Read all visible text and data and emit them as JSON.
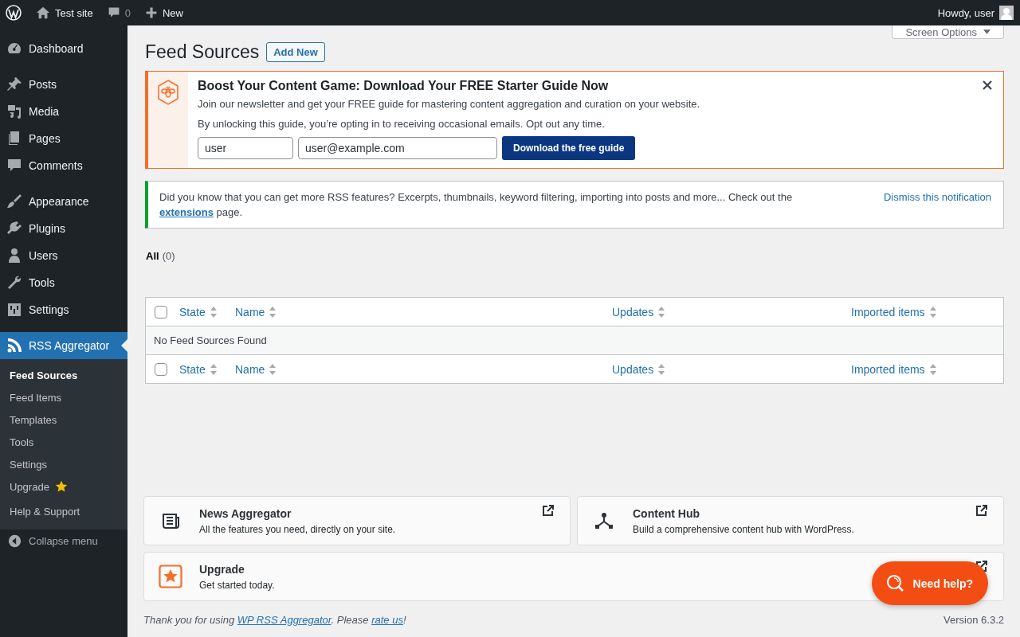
{
  "admin_bar": {
    "site_name": "Test site",
    "comments_count": "0",
    "new_label": "New",
    "greeting": "Howdy, user"
  },
  "sidebar": {
    "groups": [
      [
        {
          "label": "Dashboard",
          "selected": false
        }
      ],
      [
        {
          "label": "Posts",
          "selected": false
        },
        {
          "label": "Media",
          "selected": false
        },
        {
          "label": "Pages",
          "selected": false
        },
        {
          "label": "Comments",
          "selected": false
        }
      ],
      [
        {
          "label": "Appearance",
          "selected": false
        },
        {
          "label": "Plugins",
          "selected": false
        },
        {
          "label": "Users",
          "selected": false
        },
        {
          "label": "Tools",
          "selected": false
        },
        {
          "label": "Settings",
          "selected": false
        }
      ],
      [
        {
          "label": "RSS Aggregator",
          "selected": true
        }
      ]
    ],
    "submenu": [
      {
        "label": "Feed Sources",
        "selected": true,
        "kind": "link"
      },
      {
        "label": "Feed Items",
        "selected": false,
        "kind": "link"
      },
      {
        "label": "Templates",
        "selected": false,
        "kind": "link"
      },
      {
        "label": "Tools",
        "selected": false,
        "kind": "link"
      },
      {
        "label": "Settings",
        "selected": false,
        "kind": "link"
      },
      {
        "label": "Upgrade",
        "selected": false,
        "kind": "upgrade"
      },
      {
        "label": "Help & Support",
        "selected": false,
        "kind": "link"
      }
    ],
    "collapse_label": "Collapse menu"
  },
  "page": {
    "title": "Feed Sources",
    "add_new_label": "Add New",
    "screen_options_label": "Screen Options"
  },
  "promo": {
    "title": "Boost Your Content Game: Download Your FREE Starter Guide Now",
    "text": "Join our newsletter and get your FREE guide for mastering content aggregation and curation on your website.",
    "consent": "By unlocking this guide, you’re opting in to receiving occasional emails. Opt out any time.",
    "name_value": "user",
    "email_value": "user@example.com",
    "button_label": "Download the free guide"
  },
  "notice": {
    "text_before": "Did you know that you can get more RSS features? Excerpts, thumbnails, keyword filtering, importing into posts and more... Check out the ",
    "link": "extensions",
    "text_after": " page.",
    "dismiss_label": "Dismiss this notification"
  },
  "filters": [
    {
      "label": "All",
      "count": "(0)",
      "selected": true
    }
  ],
  "table": {
    "columns": [
      {
        "label": "State"
      },
      {
        "label": "Name"
      },
      {
        "label": "Updates"
      },
      {
        "label": "Imported items"
      }
    ],
    "footer_columns": [
      {
        "label": "State"
      },
      {
        "label": "Name"
      },
      {
        "label": "Updates"
      },
      {
        "label": "Imported items"
      }
    ],
    "header_checked": false,
    "footer_checked": false,
    "empty_message": "No Feed Sources Found"
  },
  "cards": [
    {
      "title": "News Aggregator",
      "description": "All the features you need, directly on your site."
    },
    {
      "title": "Content Hub",
      "description": "Build a comprehensive content hub with WordPress."
    },
    {
      "title": "Upgrade",
      "description": "Get started today."
    }
  ],
  "help_button": "Need help?",
  "footer": {
    "text_before": "Thank you for using ",
    "link1": "WP RSS Aggregator",
    "text_middle": ". Please ",
    "link2": "rate us",
    "text_after": "!",
    "version": "Version 6.3.2"
  }
}
